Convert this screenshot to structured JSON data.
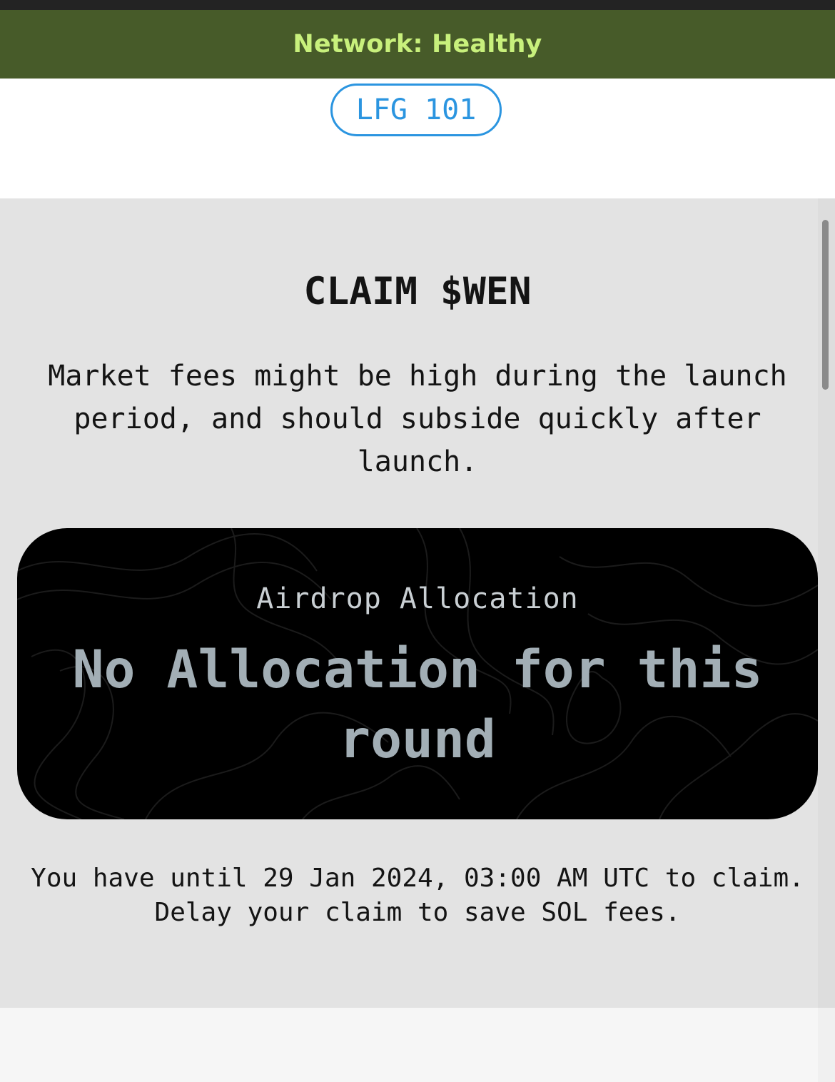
{
  "network_banner": {
    "text": "Network: Healthy"
  },
  "header": {
    "lfg_button_label": "LFG 101"
  },
  "claim": {
    "title": "CLAIM $WEN",
    "fees_note": "Market fees might be high during the launch period, and should subside quickly after launch.",
    "allocation_card": {
      "label": "Airdrop Allocation",
      "value": "No Allocation for this round"
    },
    "deadline_line1": "You have until 29 Jan 2024, 03:00 AM UTC to claim.",
    "deadline_line2": "Delay your claim to save SOL fees."
  },
  "colors": {
    "banner_bg": "#475b29",
    "banner_text": "#c8f07c",
    "accent_blue": "#2b95e0",
    "panel_bg": "#e3e3e3",
    "card_bg": "#000000",
    "card_value": "#a2aeb5"
  },
  "icons": {
    "card_background": "topographic-contour-pattern"
  }
}
